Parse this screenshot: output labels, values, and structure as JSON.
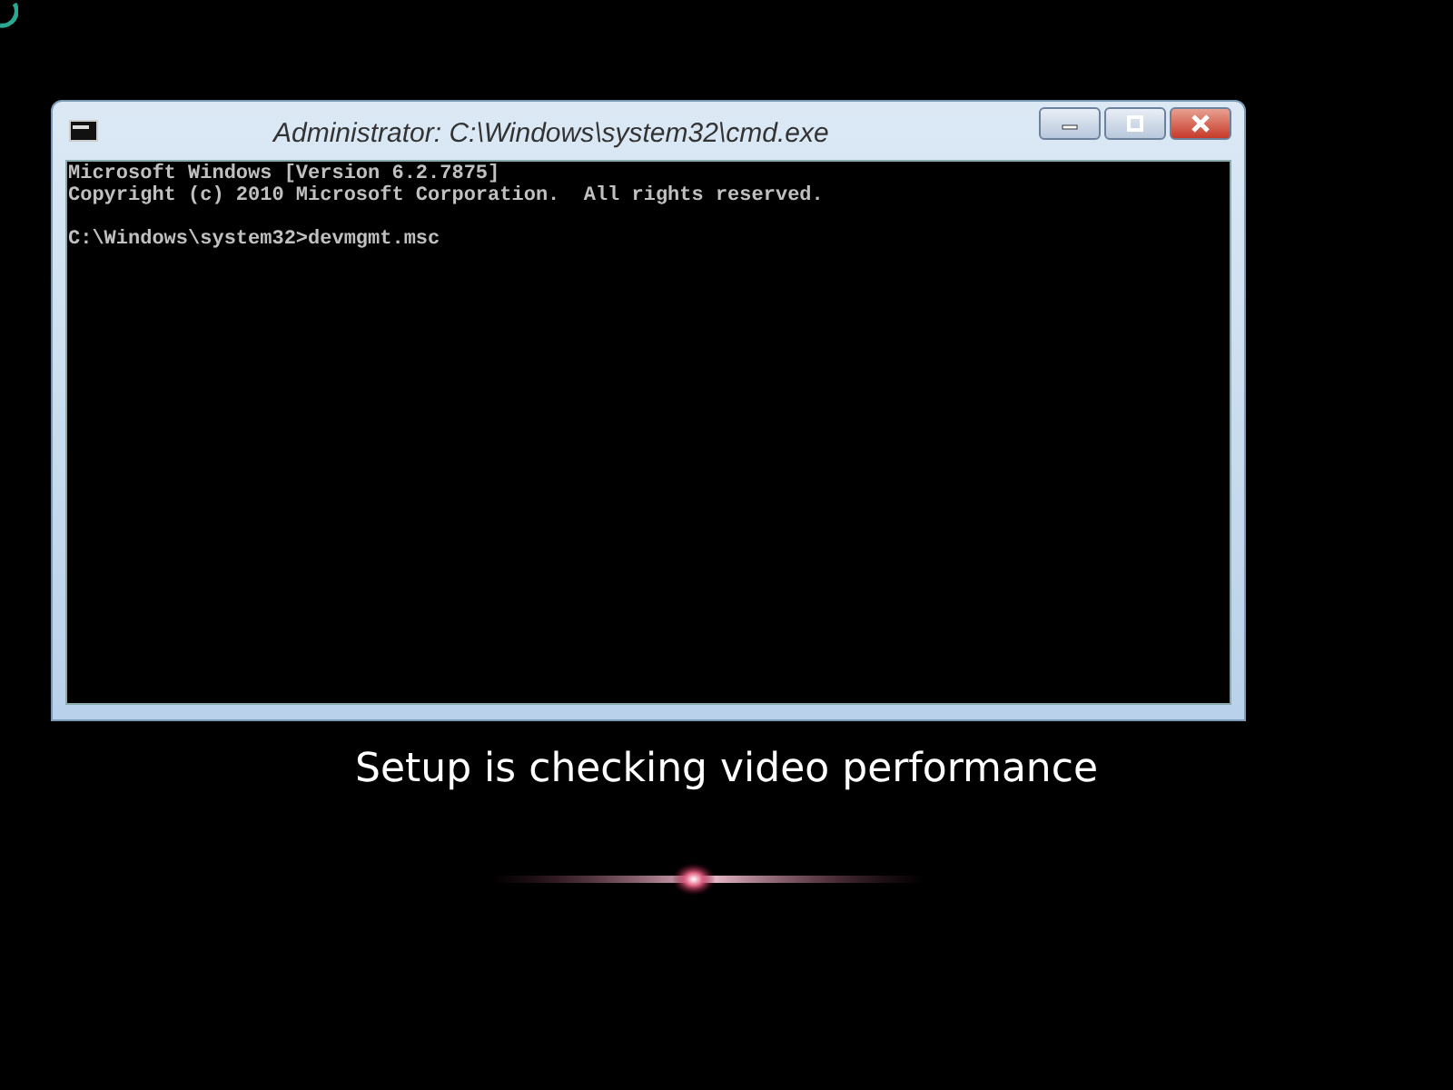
{
  "window": {
    "title": "Administrator: C:\\Windows\\system32\\cmd.exe"
  },
  "console": {
    "blocks": [
      [
        "Microsoft Windows [Version 6.2.7875]",
        "Copyright (c) 2010 Microsoft Corporation.  All rights reserved."
      ],
      [
        "C:\\Windows\\system32>devmgmt.msc"
      ]
    ]
  },
  "status": {
    "message": "Setup is checking video performance"
  }
}
